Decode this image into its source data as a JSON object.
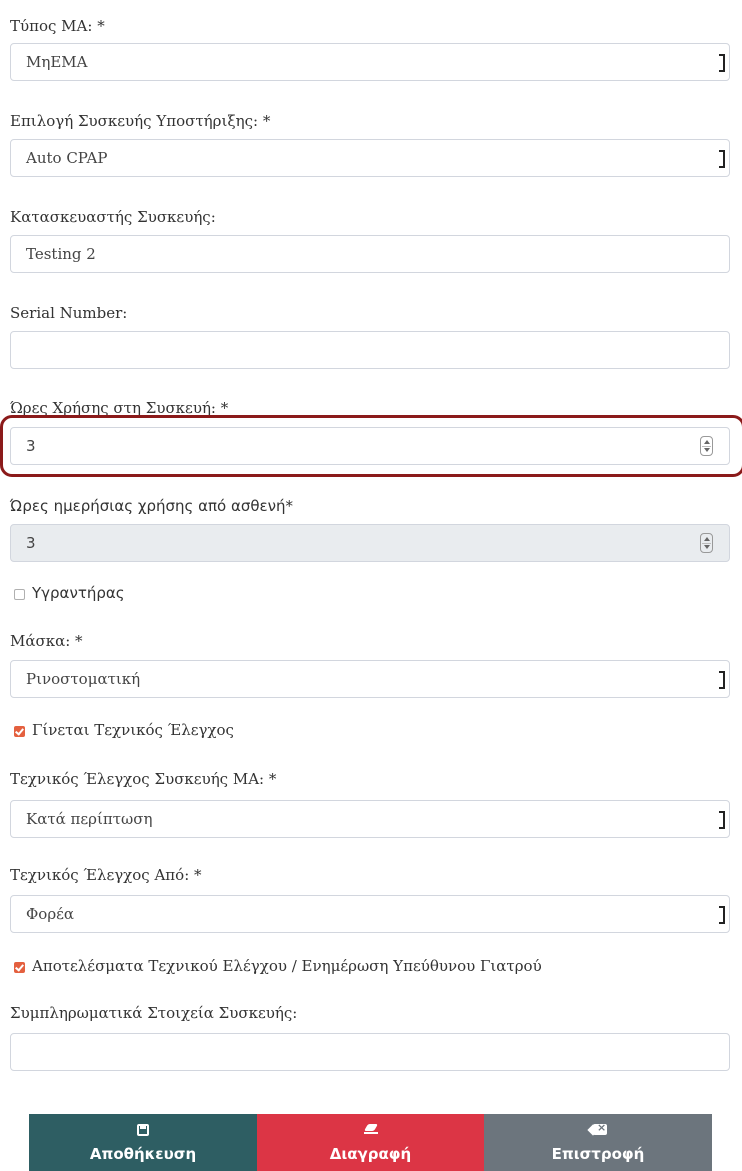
{
  "form": {
    "ma_type": {
      "label": "Τύπος ΜΑ: *",
      "value": "ΜηΕΜΑ"
    },
    "support_device": {
      "label": "Επιλογή Συσκευής Υποστήριξης: *",
      "value": "Auto CPAP"
    },
    "manufacturer": {
      "label": "Κατασκευαστής Συσκευής:",
      "value": "Testing 2"
    },
    "serial": {
      "label": "Serial Number:",
      "value": ""
    },
    "usage_hours": {
      "label": "Ώρες Χρήσης στη Συσκευή: *",
      "value": "3"
    },
    "daily_hours": {
      "label": "Ώρες ημερήσιας χρήσης από ασθενή*",
      "value": "3"
    },
    "humidifier": {
      "label": "Υγραντήρας",
      "checked": false
    },
    "mask": {
      "label": "Μάσκα: *",
      "value": "Ρινοστοματική"
    },
    "tech_check": {
      "label": "Γίνεται Τεχνικός Έλεγχος",
      "checked": true
    },
    "tech_check_device": {
      "label": "Τεχνικός Έλεγχος Συσκευής ΜΑ: *",
      "value": "Κατά περίπτωση"
    },
    "tech_check_by": {
      "label": "Τεχνικός Έλεγχος Από: *",
      "value": "Φορέα"
    },
    "tech_results": {
      "label": "Αποτελέσματα Τεχνικού Ελέγχου / Ενημέρωση Υπεύθυνου Γιατρού",
      "checked": true
    },
    "extra": {
      "label": "Συμπληρωματικά Στοιχεία Συσκευής:",
      "value": ""
    }
  },
  "actions": {
    "save": {
      "label": "Αποθήκευση",
      "icon": "floppy-disk-icon",
      "color": "#2e5e63"
    },
    "delete": {
      "label": "Διαγραφή",
      "icon": "eraser-icon",
      "color": "#dc3545"
    },
    "back": {
      "label": "Επιστροφή",
      "icon": "backspace-icon",
      "color": "#6c757d"
    }
  },
  "colors": {
    "highlight": "#8b1a1a",
    "checkbox_accent": "#e4603f"
  }
}
